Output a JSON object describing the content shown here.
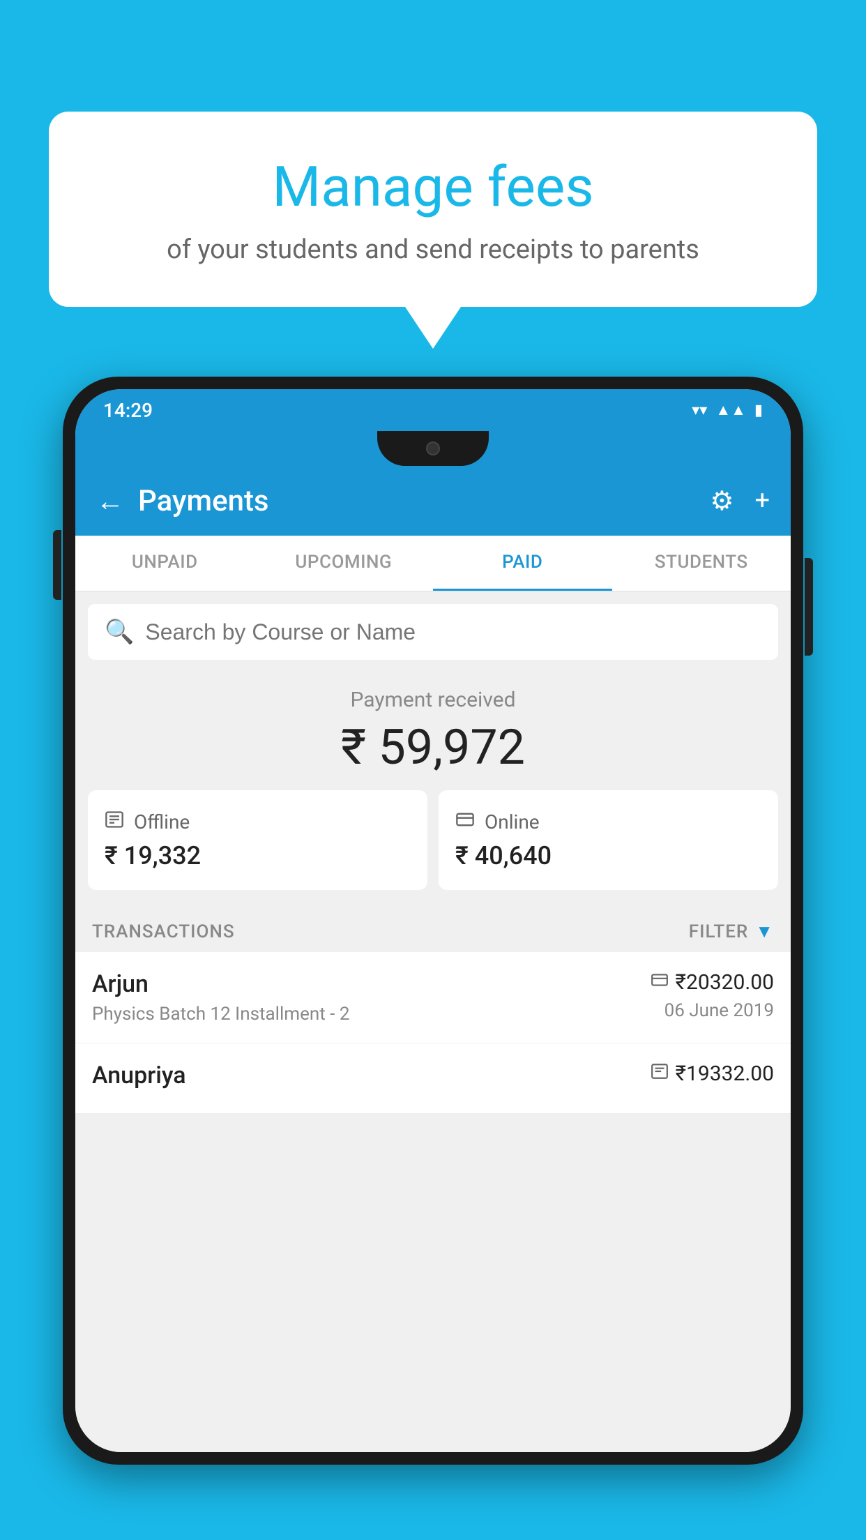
{
  "background": {
    "color": "#1ab8e8"
  },
  "speech_bubble": {
    "title": "Manage fees",
    "subtitle": "of your students and send receipts to parents"
  },
  "status_bar": {
    "time": "14:29",
    "icons": [
      "wifi",
      "signal",
      "battery"
    ]
  },
  "app_bar": {
    "title": "Payments",
    "back_label": "←",
    "settings_icon": "⚙",
    "add_icon": "+"
  },
  "tabs": [
    {
      "label": "UNPAID",
      "active": false
    },
    {
      "label": "UPCOMING",
      "active": false
    },
    {
      "label": "PAID",
      "active": true
    },
    {
      "label": "STUDENTS",
      "active": false
    }
  ],
  "search": {
    "placeholder": "Search by Course or Name"
  },
  "payment_section": {
    "label": "Payment received",
    "total_amount": "₹ 59,972",
    "offline": {
      "label": "Offline",
      "amount": "₹ 19,332"
    },
    "online": {
      "label": "Online",
      "amount": "₹ 40,640"
    }
  },
  "transactions": {
    "header_label": "TRANSACTIONS",
    "filter_label": "FILTER",
    "rows": [
      {
        "name": "Arjun",
        "course": "Physics Batch 12 Installment - 2",
        "amount": "₹20320.00",
        "date": "06 June 2019",
        "payment_type": "card"
      },
      {
        "name": "Anupriya",
        "course": "",
        "amount": "₹19332.00",
        "date": "",
        "payment_type": "offline"
      }
    ]
  }
}
